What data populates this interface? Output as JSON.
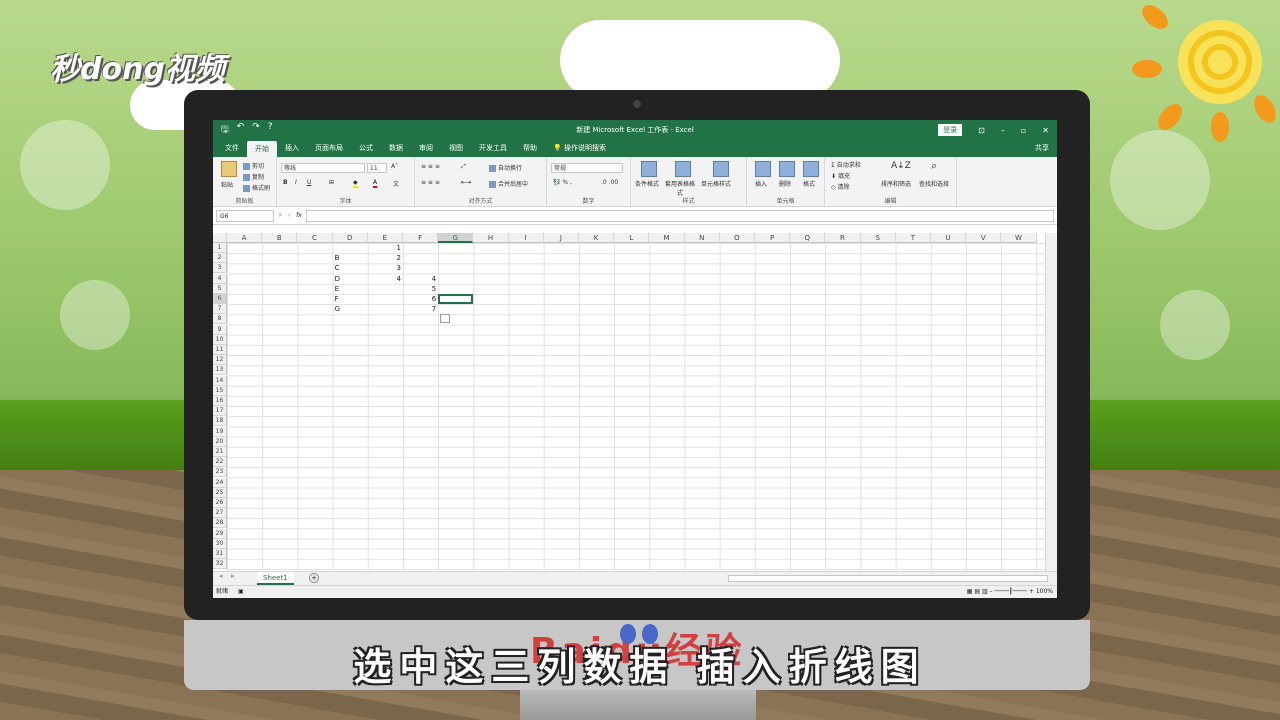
{
  "brand": {
    "logo_text": "秒dong视频"
  },
  "excel": {
    "window_title": "新建 Microsoft Excel 工作表 - Excel",
    "login_label": "登录",
    "share_label": "共享",
    "tabs": [
      "文件",
      "开始",
      "插入",
      "页面布局",
      "公式",
      "数据",
      "审阅",
      "视图",
      "开发工具",
      "帮助"
    ],
    "active_tab": "开始",
    "tell_me": "操作说明搜索",
    "ribbon": {
      "clipboard": {
        "label": "剪贴板",
        "paste": "粘贴",
        "cut": "剪切",
        "copy": "复制",
        "format_painter": "格式刷"
      },
      "font": {
        "label": "字体",
        "font_name": "等线",
        "font_size": "11",
        "bold": "B",
        "italic": "I",
        "underline": "U"
      },
      "alignment": {
        "label": "对齐方式",
        "wrap": "自动换行",
        "merge": "合并后居中"
      },
      "number": {
        "label": "数字",
        "format": "常规"
      },
      "styles": {
        "label": "样式",
        "conditional": "条件格式",
        "table": "套用表格格式",
        "cell_styles": "单元格样式"
      },
      "cells": {
        "label": "单元格",
        "insert": "插入",
        "delete": "删除",
        "format": "格式"
      },
      "editing": {
        "label": "编辑",
        "autosum": "自动求和",
        "fill": "填充",
        "clear": "清除",
        "sort": "排序和筛选",
        "find": "查找和选择"
      }
    },
    "name_box": "G6",
    "fx": "fx",
    "columns": [
      "A",
      "B",
      "C",
      "D",
      "E",
      "F",
      "G",
      "H",
      "I",
      "J",
      "K",
      "L",
      "M",
      "N",
      "O",
      "P",
      "Q",
      "R",
      "S",
      "T",
      "U",
      "V",
      "W"
    ],
    "selected_column": "G",
    "row_count": 32,
    "selected_row": "6",
    "cells": [
      {
        "col": "D",
        "row": 2,
        "value": "B"
      },
      {
        "col": "D",
        "row": 3,
        "value": "C"
      },
      {
        "col": "D",
        "row": 4,
        "value": "D"
      },
      {
        "col": "D",
        "row": 5,
        "value": "E"
      },
      {
        "col": "D",
        "row": 6,
        "value": "F"
      },
      {
        "col": "D",
        "row": 7,
        "value": "G"
      },
      {
        "col": "E",
        "row": 1,
        "value": "1"
      },
      {
        "col": "E",
        "row": 2,
        "value": "2"
      },
      {
        "col": "E",
        "row": 3,
        "value": "3"
      },
      {
        "col": "E",
        "row": 4,
        "value": "4"
      },
      {
        "col": "F",
        "row": 4,
        "value": "4"
      },
      {
        "col": "F",
        "row": 5,
        "value": "5"
      },
      {
        "col": "F",
        "row": 6,
        "value": "6"
      },
      {
        "col": "F",
        "row": 7,
        "value": "7"
      }
    ],
    "sheet_tab": "Sheet1",
    "status": "就绪",
    "zoom": "100%"
  },
  "subtitle": "选中这三列数据 插入折线图",
  "watermark": "Baidu经验",
  "colors": {
    "excel_green": "#217346",
    "sun": "#f4c51f"
  }
}
